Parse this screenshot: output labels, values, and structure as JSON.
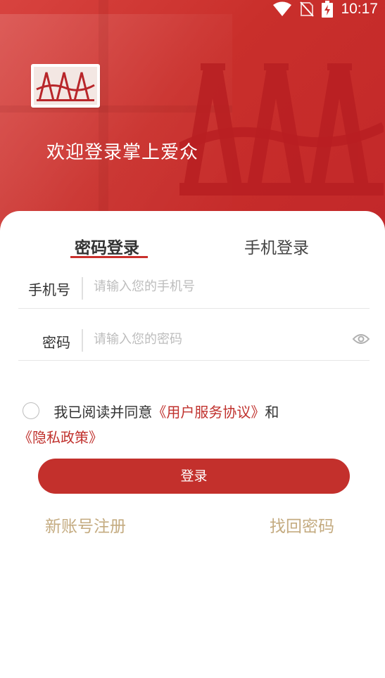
{
  "status_bar": {
    "time": "10:17"
  },
  "header": {
    "welcome": "欢迎登录掌上爱众",
    "brand_color": "#c9302c"
  },
  "tabs": [
    {
      "label": "密码登录",
      "active": true
    },
    {
      "label": "手机登录",
      "active": false
    }
  ],
  "form": {
    "phone": {
      "label": "手机号",
      "placeholder": "请输入您的手机号",
      "value": ""
    },
    "password": {
      "label": "密码",
      "placeholder": "请输入您的密码",
      "value": ""
    }
  },
  "agreement": {
    "checked": false,
    "prefix": "我已阅读并同意",
    "service_link": "《用户服务协议》",
    "conjunction": "和",
    "privacy_link": "《隐私政策》"
  },
  "login_button": "登录",
  "links": {
    "register": "新账号注册",
    "forgot": "找回密码"
  },
  "colors": {
    "accent": "#c3302c",
    "link_gold": "#c4ab80",
    "placeholder": "#bdbdbd"
  }
}
